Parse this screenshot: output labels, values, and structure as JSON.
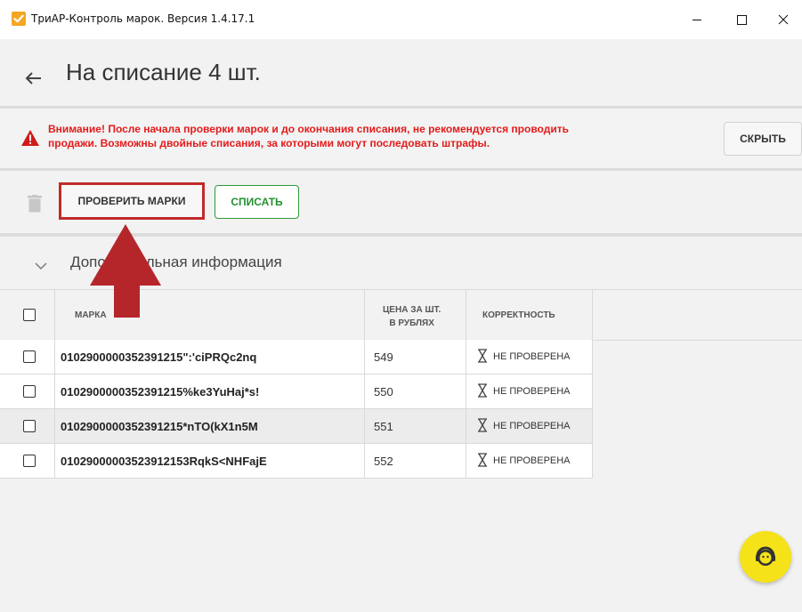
{
  "window": {
    "title": "ТриАР-Контроль марок. Версия 1.4.17.1"
  },
  "header": {
    "title": "На списание 4 шт."
  },
  "warning": {
    "text_line1": "Внимание! После начала проверки марок и до окончания списания, не рекомендуется проводить",
    "text_line2": "продажи. Возможны двойные списания, за которыми могут последовать штрафы.",
    "hide_label": "СКРЫТЬ"
  },
  "toolbar": {
    "check_label": "ПРОВЕРИТЬ МАРКИ",
    "writeoff_label": "СПИСАТЬ"
  },
  "extra_info": {
    "label": "Дополнительная информация"
  },
  "table": {
    "headers": {
      "mark": "МАРКА",
      "price_line1": "ЦЕНА ЗА ШТ.",
      "price_line2": "В РУБЛЯХ",
      "status": "КОРРЕКТНОСТЬ"
    },
    "rows": [
      {
        "mark": "0102900000352391215\":'ciPRQc2nq",
        "price": "549",
        "status": "НЕ ПРОВЕРЕНА"
      },
      {
        "mark": "0102900000352391215%ke3YuHaj*s!",
        "price": "550",
        "status": "НЕ ПРОВЕРЕНА"
      },
      {
        "mark": "0102900000352391215*nTO(kX1n5M",
        "price": "551",
        "status": "НЕ ПРОВЕРЕНА"
      },
      {
        "mark": "01029000003523912153RqkS<NHFajE",
        "price": "552",
        "status": "НЕ ПРОВЕРЕНА"
      }
    ]
  },
  "colors": {
    "warning_text": "#e31b1b",
    "accent_green": "#23902f",
    "annotation_red": "#b5262b",
    "fab_yellow": "#f5e218"
  },
  "icons": {
    "app": "app-check-icon",
    "back": "back-arrow-icon",
    "warning": "warning-triangle-icon",
    "trash": "trash-icon",
    "chevron": "chevron-down-icon",
    "hourglass": "hourglass-icon",
    "support": "support-face-icon"
  }
}
